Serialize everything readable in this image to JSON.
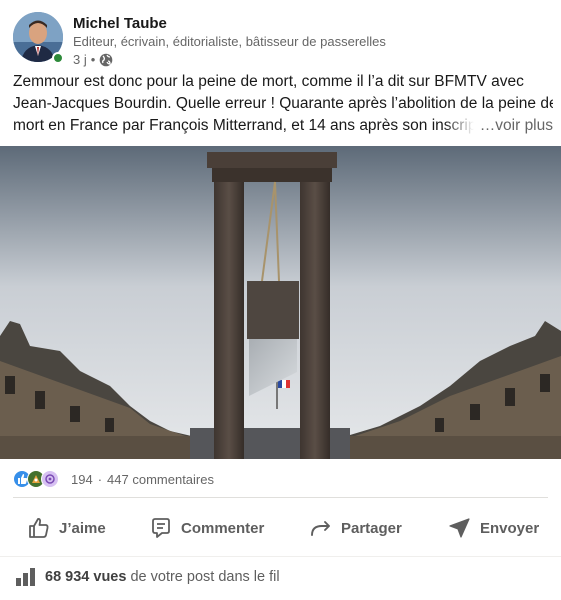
{
  "author": {
    "name": "Michel Taube",
    "headline": "Editeur, écrivain, éditorialiste, bâtisseur de passerelles",
    "time": "3 j",
    "separator": "•",
    "visibility_icon": "globe-icon",
    "online": true
  },
  "post": {
    "lines": [
      "Zemmour est donc pour la peine de mort, comme il l’a dit sur BFMTV avec",
      "Jean-Jacques Bourdin. Quelle erreur ! Quarante après l’abolition de la peine de",
      "mort en France par François Mitterrand, et 14 ans après son inscript"
    ],
    "see_more": "…voir plus",
    "image_subject": "guillotine"
  },
  "social": {
    "reaction_icons": [
      "like-icon",
      "celebrate-icon",
      "curious-icon"
    ],
    "reactions_count": "194",
    "separator": "·",
    "comments": "447 commentaires"
  },
  "actions": {
    "like": "J’aime",
    "comment": "Commenter",
    "share": "Partager",
    "send": "Envoyer"
  },
  "views": {
    "count": "68 934 vues",
    "suffix": "de votre post dans le fil"
  },
  "colors": {
    "text": "#191919",
    "secondary": "#666666",
    "action": "#5e5e5e",
    "like_blue": "#378fe9",
    "presence_green": "#2d8a3a",
    "divider": "#e0dfdc"
  }
}
